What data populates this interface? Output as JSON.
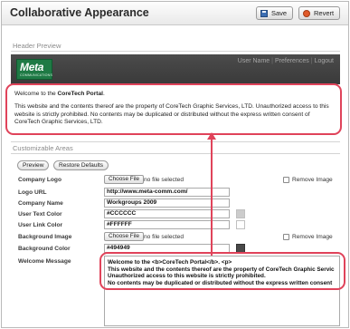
{
  "window": {
    "title": "Collaborative Appearance",
    "save_label": "Save",
    "revert_label": "Revert"
  },
  "header_preview": {
    "section_label": "Header Preview",
    "logo_text": "Meta",
    "logo_sub": "COMMUNICATIONS",
    "links": [
      "User Name",
      "Preferences",
      "Logout"
    ],
    "welcome_prefix": "Welcome to the ",
    "welcome_brand": "CoreTech Portal",
    "welcome_suffix": ".",
    "notice": "This website and the contents thereof are the property of CoreTech Graphic Services, LTD. Unauthorized access to this website is strictly prohibited. No contents may be duplicated or distributed without the express written consent of CoreTech Graphic Services, LTD."
  },
  "customizable": {
    "section_label": "Customizable Areas",
    "preview_button": "Preview",
    "restore_button": "Restore Defaults",
    "choose_file_label": "Choose File",
    "no_file_label": "no file selected",
    "remove_image_label": "Remove Image",
    "fields": {
      "company_logo": "Company Logo",
      "logo_url": "Logo URL",
      "company_name": "Company Name",
      "user_text_color": "User Text Color",
      "user_link_color": "User Link Color",
      "background_image": "Background Image",
      "background_color": "Background Color",
      "welcome_message": "Welcome Message"
    },
    "values": {
      "logo_url": "http://www.meta-comm.com/",
      "company_name": "Workgroups 2009",
      "user_text_color": "#CCCCCC",
      "user_link_color": "#FFFFFF",
      "background_color": "#494949"
    },
    "welcome_message_lines": [
      "Welcome to the <b>CoreTech Portal</b>. <p>",
      "This website and the contents thereof are the property of CoreTech Graphic Servic",
      "Unauthorized access to this website is strictly prohibited.",
      "No contents may be duplicated or distributed without the express written consent"
    ]
  },
  "colors": {
    "callout": "#e0435a",
    "banner": "#3a3a3a",
    "logo_green": "#1f7a45",
    "swatch_user_text": "#cccccc",
    "swatch_user_link": "#ffffff",
    "swatch_background": "#494949"
  }
}
